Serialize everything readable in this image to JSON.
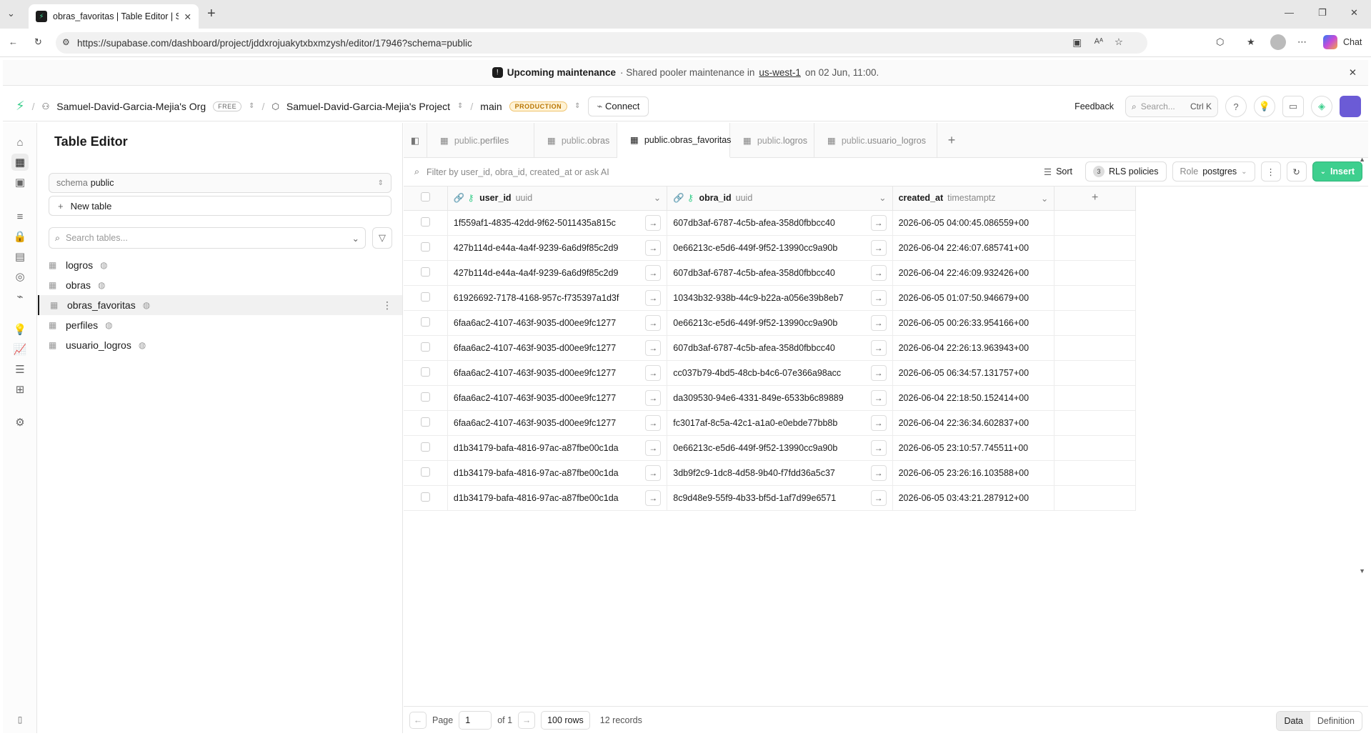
{
  "browser": {
    "tab_title": "obras_favoritas | Table Editor | Sam",
    "url": "https://supabase.com/dashboard/project/jddxrojuakytxbxmzysh/editor/17946?schema=public",
    "chat_label": "Chat"
  },
  "banner": {
    "title": "Upcoming maintenance",
    "text_prefix": "· Shared pooler maintenance in",
    "region": "us-west-1",
    "text_suffix": "on 02 Jun, 11:00."
  },
  "topnav": {
    "org": "Samuel-David-Garcia-Mejia's Org",
    "org_badge": "FREE",
    "project": "Samuel-David-Garcia-Mejia's Project",
    "branch": "main",
    "branch_badge": "PRODUCTION",
    "connect": "Connect",
    "feedback": "Feedback",
    "search_placeholder": "Search...",
    "search_shortcut": "Ctrl K"
  },
  "sidebar": {
    "title": "Table Editor",
    "schema_label": "schema",
    "schema_value": "public",
    "new_table": "New table",
    "search_placeholder": "Search tables...",
    "tables": [
      {
        "name": "logros"
      },
      {
        "name": "obras"
      },
      {
        "name": "obras_favoritas"
      },
      {
        "name": "perfiles"
      },
      {
        "name": "usuario_logros"
      }
    ]
  },
  "tabs": [
    {
      "schema": "public.",
      "name": "perfiles"
    },
    {
      "schema": "public.",
      "name": "obras"
    },
    {
      "schema": "public.",
      "name": "obras_favoritas"
    },
    {
      "schema": "public.",
      "name": "logros"
    },
    {
      "schema": "public.",
      "name": "usuario_logros"
    }
  ],
  "toolbar": {
    "filter_placeholder": "Filter by user_id, obra_id, created_at or ask AI",
    "sort": "Sort",
    "rls_count": "3",
    "rls_label": "RLS policies",
    "role_label": "Role",
    "role_value": "postgres",
    "insert": "Insert"
  },
  "grid": {
    "columns": [
      {
        "name": "user_id",
        "type": "uuid"
      },
      {
        "name": "obra_id",
        "type": "uuid"
      },
      {
        "name": "created_at",
        "type": "timestamptz"
      }
    ],
    "rows": [
      {
        "user_id": "1f559af1-4835-42dd-9f62-5011435a815c",
        "obra_id": "607db3af-6787-4c5b-afea-358d0fbbcc40",
        "created_at": "2026-06-05 04:00:45.086559+00"
      },
      {
        "user_id": "427b114d-e44a-4a4f-9239-6a6d9f85c2d9",
        "obra_id": "0e66213c-e5d6-449f-9f52-13990cc9a90b",
        "created_at": "2026-06-04 22:46:07.685741+00"
      },
      {
        "user_id": "427b114d-e44a-4a4f-9239-6a6d9f85c2d9",
        "obra_id": "607db3af-6787-4c5b-afea-358d0fbbcc40",
        "created_at": "2026-06-04 22:46:09.932426+00"
      },
      {
        "user_id": "61926692-7178-4168-957c-f735397a1d3f",
        "obra_id": "10343b32-938b-44c9-b22a-a056e39b8eb7",
        "created_at": "2026-06-05 01:07:50.946679+00"
      },
      {
        "user_id": "6faa6ac2-4107-463f-9035-d00ee9fc1277",
        "obra_id": "0e66213c-e5d6-449f-9f52-13990cc9a90b",
        "created_at": "2026-06-05 00:26:33.954166+00"
      },
      {
        "user_id": "6faa6ac2-4107-463f-9035-d00ee9fc1277",
        "obra_id": "607db3af-6787-4c5b-afea-358d0fbbcc40",
        "created_at": "2026-06-04 22:26:13.963943+00"
      },
      {
        "user_id": "6faa6ac2-4107-463f-9035-d00ee9fc1277",
        "obra_id": "cc037b79-4bd5-48cb-b4c6-07e366a98acc",
        "created_at": "2026-06-05 06:34:57.131757+00"
      },
      {
        "user_id": "6faa6ac2-4107-463f-9035-d00ee9fc1277",
        "obra_id": "da309530-94e6-4331-849e-6533b6c89889",
        "created_at": "2026-06-04 22:18:50.152414+00"
      },
      {
        "user_id": "6faa6ac2-4107-463f-9035-d00ee9fc1277",
        "obra_id": "fc3017af-8c5a-42c1-a1a0-e0ebde77bb8b",
        "created_at": "2026-06-04 22:36:34.602837+00"
      },
      {
        "user_id": "d1b34179-bafa-4816-97ac-a87fbe00c1da",
        "obra_id": "0e66213c-e5d6-449f-9f52-13990cc9a90b",
        "created_at": "2026-06-05 23:10:57.745511+00"
      },
      {
        "user_id": "d1b34179-bafa-4816-97ac-a87fbe00c1da",
        "obra_id": "3db9f2c9-1dc8-4d58-9b40-f7fdd36a5c37",
        "created_at": "2026-06-05 23:26:16.103588+00"
      },
      {
        "user_id": "d1b34179-bafa-4816-97ac-a87fbe00c1da",
        "obra_id": "8c9d48e9-55f9-4b33-bf5d-1af7d99e6571",
        "created_at": "2026-06-05 03:43:21.287912+00"
      }
    ]
  },
  "footer": {
    "page_label": "Page",
    "page_value": "1",
    "of_label": "of 1",
    "rows_per_page": "100 rows",
    "records": "12 records",
    "view_data": "Data",
    "view_definition": "Definition"
  },
  "colors": {
    "brand": "#3ecf8e",
    "production_badge": "#f0c36d"
  }
}
